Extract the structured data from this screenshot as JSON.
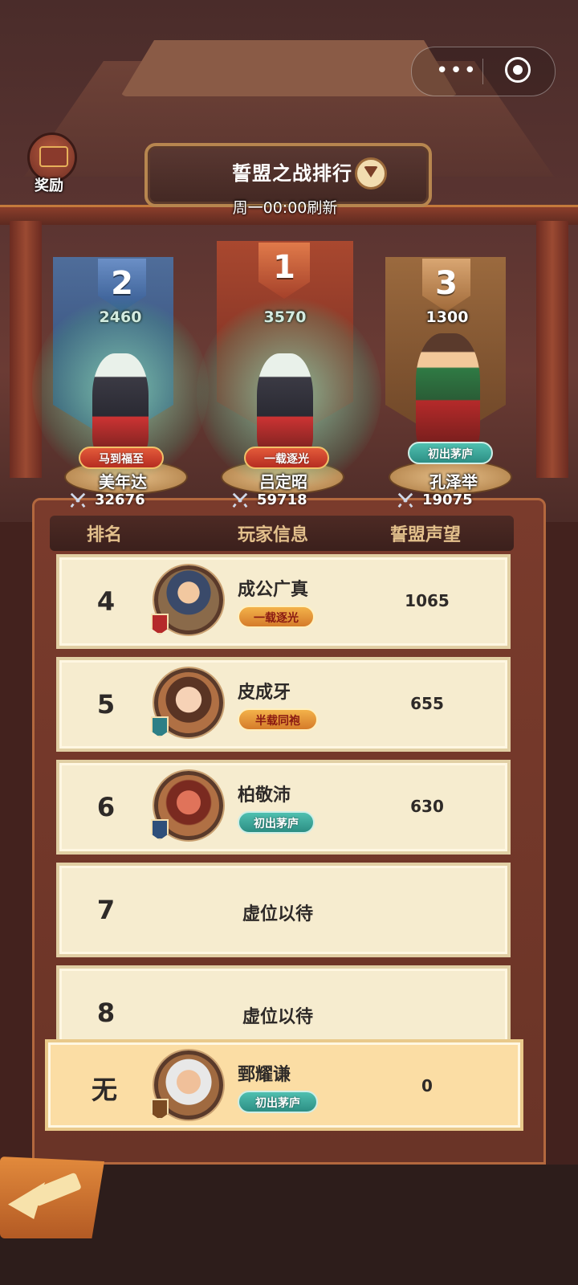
{
  "header": {
    "reward_label": "奖励",
    "title": "誓盟之战排行",
    "refresh_note": "周一00:00刷新"
  },
  "podium": [
    {
      "rank": "2",
      "score": "2460",
      "tag": "马到福至",
      "name": "美年达",
      "power": "32676"
    },
    {
      "rank": "1",
      "score": "3570",
      "tag": "一载逐光",
      "name": "吕定昭",
      "power": "59718"
    },
    {
      "rank": "3",
      "score": "1300",
      "tag": "初出茅庐",
      "name": "孔泽举",
      "power": "19075"
    }
  ],
  "table": {
    "columns": [
      "排名",
      "玩家信息",
      "誓盟声望"
    ],
    "rows": [
      {
        "rank": "4",
        "name": "成公广真",
        "tag": "一载逐光",
        "score": "1065"
      },
      {
        "rank": "5",
        "name": "皮成牙",
        "tag": "半载同袍",
        "score": "655"
      },
      {
        "rank": "6",
        "name": "柏敬沛",
        "tag": "初出茅庐",
        "score": "630"
      },
      {
        "rank": "7",
        "vacant": "虚位以待"
      },
      {
        "rank": "8",
        "vacant": "虚位以待"
      }
    ],
    "me": {
      "rank": "无",
      "name": "鄄耀谦",
      "tag": "初出茅庐",
      "score": "0"
    }
  },
  "colors": {
    "panel": "#7a3b2c",
    "row_bg": "#f6eccf",
    "self_row_bg": "#fbdda4",
    "header_text": "#e3c08c"
  },
  "icons": [
    "more-dots-icon",
    "close-target-icon",
    "treasure-chest-icon",
    "chevron-down-icon",
    "crossed-swords-icon",
    "back-arrow-icon"
  ]
}
